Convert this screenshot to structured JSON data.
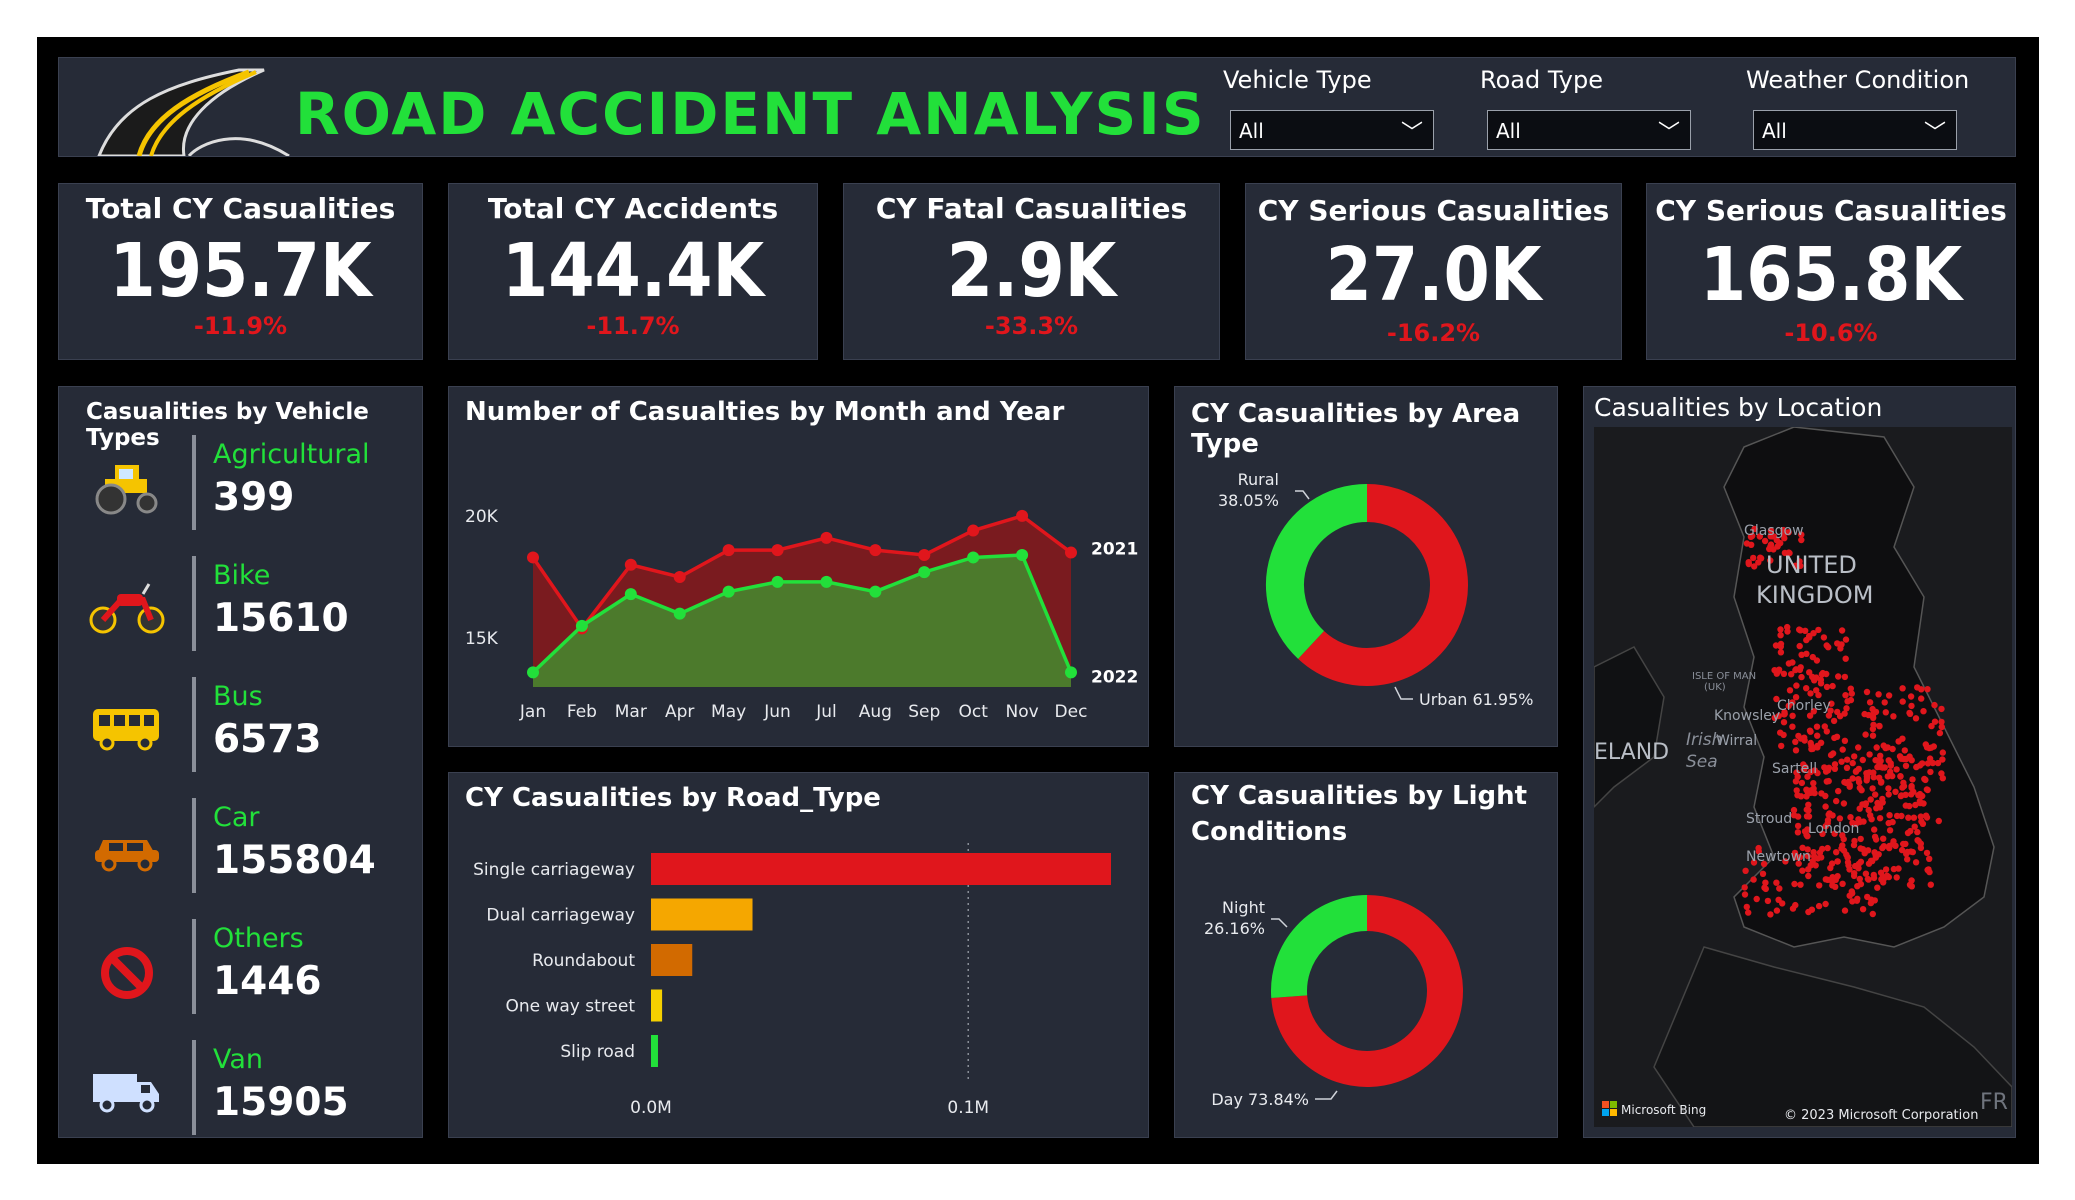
{
  "header": {
    "title": "ROAD ACCIDENT ANALYSIS",
    "filters": [
      {
        "label": "Vehicle Type",
        "value": "All"
      },
      {
        "label": "Road Type",
        "value": "All"
      },
      {
        "label": "Weather Condition",
        "value": "All"
      }
    ]
  },
  "kpis": [
    {
      "title": "Total CY Casualities",
      "value": "195.7K",
      "delta": "-11.9%"
    },
    {
      "title": "Total CY Accidents",
      "value": "144.4K",
      "delta": "-11.7%"
    },
    {
      "title": "CY Fatal Casualities",
      "value": "2.9K",
      "delta": "-33.3%"
    },
    {
      "title": "CY Serious Casualities",
      "value": "27.0K",
      "delta": "-16.2%"
    },
    {
      "title": "CY Serious Casualities",
      "value": "165.8K",
      "delta": "-10.6%"
    }
  ],
  "vehicles": {
    "title": "Casualities by Vehicle Types",
    "items": [
      {
        "name": "Agricultural",
        "value": "399",
        "icon": "tractor-icon"
      },
      {
        "name": "Bike",
        "value": "15610",
        "icon": "motorbike-icon"
      },
      {
        "name": "Bus",
        "value": "6573",
        "icon": "bus-icon"
      },
      {
        "name": "Car",
        "value": "155804",
        "icon": "car-icon"
      },
      {
        "name": "Others",
        "value": "1446",
        "icon": "prohibited-icon"
      },
      {
        "name": "Van",
        "value": "15905",
        "icon": "van-icon"
      }
    ]
  },
  "area_type": {
    "title": "CY Casualities by Area Type",
    "rural_label": "Rural",
    "rural_pct": "38.05%",
    "urban_label": "Urban 61.95%"
  },
  "light": {
    "title_line1": "CY Casualities by Light",
    "title_line2": "Conditions",
    "night_label": "Night",
    "night_pct": "26.16%",
    "day_label": "Day 73.84%"
  },
  "location": {
    "title": "Casualities by Location",
    "labels": {
      "glasgow": "Glasgow",
      "uk1": "UNITED",
      "uk2": "KINGDOM",
      "isle1": "ISLE OF MAN",
      "isle2": "(UK)",
      "knowsley": "Knowsley",
      "chorley": "Chorley",
      "wirral": "Wirral",
      "irish1": "Irish",
      "irish2": "Sea",
      "eland": "ELAND",
      "sartell": "Sartell",
      "stroud": "Stroud",
      "london": "London",
      "newtown": "Newtown",
      "fr": "FR",
      "bing": "Microsoft Bing",
      "copyright": "© 2023 Microsoft Corporation"
    }
  },
  "chart_data": [
    {
      "type": "area",
      "title": "Number of Casualties by Month and Year",
      "categories": [
        "Jan",
        "Feb",
        "Mar",
        "Apr",
        "May",
        "Jun",
        "Jul",
        "Aug",
        "Sep",
        "Oct",
        "Nov",
        "Dec"
      ],
      "yticks": [
        "20K",
        "15K"
      ],
      "ytick_values": [
        20000,
        15000
      ],
      "ylim": [
        13000,
        22000
      ],
      "series": [
        {
          "name": "2021",
          "color": "#e0161c",
          "values": [
            18300,
            15400,
            18000,
            17500,
            18600,
            18600,
            19100,
            18600,
            18400,
            19400,
            20000,
            18500
          ]
        },
        {
          "name": "2022",
          "color": "#22e03a",
          "values": [
            13600,
            15500,
            16800,
            16000,
            16900,
            17300,
            17300,
            16900,
            17700,
            18300,
            18400,
            13600
          ]
        }
      ]
    },
    {
      "type": "bar",
      "title": "CY Casualities by Road_Type",
      "categories": [
        "Single carriageway",
        "Dual carriageway",
        "Roundabout",
        "One way street",
        "Slip road"
      ],
      "values": [
        145000,
        32000,
        13000,
        3500,
        2200
      ],
      "colors": [
        "#e0161c",
        "#f5a700",
        "#d26a00",
        "#f5d000",
        "#22e03a"
      ],
      "xticks": [
        "0.0M",
        "0.1M"
      ],
      "xtick_values": [
        0,
        100000
      ],
      "xlim": [
        0,
        145000
      ]
    },
    {
      "type": "pie",
      "title": "CY Casualities by Area Type",
      "labels": [
        "Rural",
        "Urban"
      ],
      "values": [
        38.05,
        61.95
      ],
      "colors": [
        "#22e03a",
        "#e0161c"
      ]
    },
    {
      "type": "pie",
      "title": "CY Casualities by Light Conditions",
      "labels": [
        "Night",
        "Day"
      ],
      "values": [
        26.16,
        73.84
      ],
      "colors": [
        "#22e03a",
        "#e0161c"
      ]
    }
  ]
}
